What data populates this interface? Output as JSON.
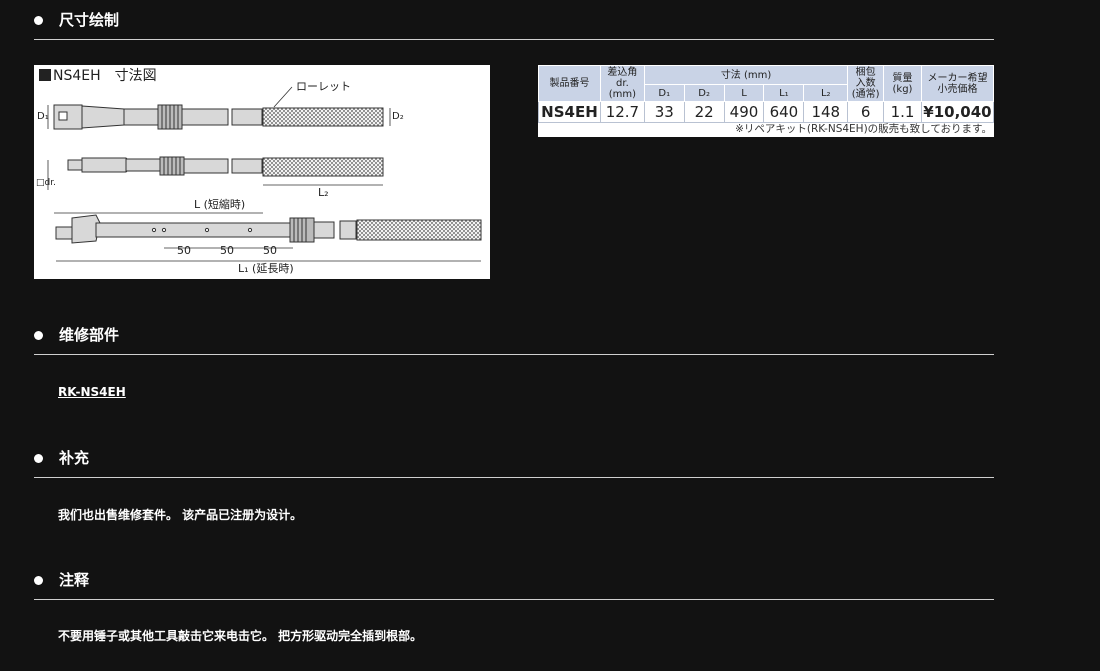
{
  "sections": {
    "drawing": {
      "title": "尺寸绘制"
    },
    "parts": {
      "title": "维修部件",
      "link": "RK-NS4EH"
    },
    "supplement": {
      "title": "补充",
      "text": "我们也出售维修套件。 该产品已注册为设计。"
    },
    "notes": {
      "title": "注释",
      "text": "不要用锤子或其他工具敲击它来电击它。 把方形驱动完全插到根部。"
    }
  },
  "drawing_panel": {
    "title": "NS4EH　寸法図",
    "labels": {
      "knurl": "ローレット",
      "d1": "D₁",
      "d2": "D₂",
      "dr": "□dr.",
      "l2": "L₂",
      "l_short": "L (短縮時)",
      "l1_ext": "L₁ (延長時)",
      "dim50a": "50",
      "dim50b": "50",
      "dim50c": "50"
    }
  },
  "spec_table": {
    "headers": {
      "model": "製品番号",
      "drive": "差込角",
      "drive_sub": "dr.",
      "drive_unit": "(mm)",
      "dims": "寸法 (mm)",
      "d1": "D₁",
      "d2": "D₂",
      "l": "L",
      "l1": "L₁",
      "l2": "L₂",
      "pack": "梱包",
      "pack_sub": "入数",
      "pack_unit": "(通常)",
      "mass": "質量",
      "mass_unit": "(kg)",
      "price": "メーカー希望",
      "price_sub": "小売価格"
    },
    "row": {
      "model": "NS4EH",
      "drive": "12.7",
      "d1": "33",
      "d2": "22",
      "l": "490",
      "l1": "640",
      "l2": "148",
      "pack": "6",
      "mass": "1.1",
      "price": "¥10,040"
    },
    "note": "※リペアキット(RK-NS4EH)の販売も致しております。"
  }
}
